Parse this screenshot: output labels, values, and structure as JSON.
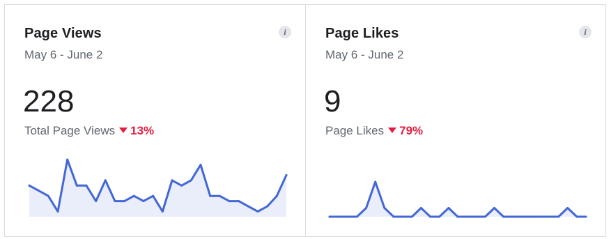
{
  "cards": [
    {
      "title": "Page Views",
      "date_range": "May 6 - June 2",
      "value": "228",
      "metric_label": "Total Page Views",
      "change": "13%",
      "change_direction": "down",
      "info_icon": "i",
      "line_color": "#4267d6",
      "fill_color": "#eaedfa",
      "chart_data": {
        "type": "area",
        "values": [
          6,
          5,
          4,
          1,
          11,
          6,
          6,
          3,
          7,
          3,
          3,
          4,
          3,
          4,
          1,
          7,
          6,
          7,
          10,
          4,
          4,
          3,
          3,
          2,
          1,
          2,
          4,
          8
        ]
      }
    },
    {
      "title": "Page Likes",
      "date_range": "May 6 - June 2",
      "value": "9",
      "metric_label": "Page Likes",
      "change": "79%",
      "change_direction": "down",
      "info_icon": "i",
      "line_color": "#4267d6",
      "fill_color": "#eaedfa",
      "chart_data": {
        "type": "area",
        "values": [
          0,
          0,
          0,
          0,
          1,
          4,
          1,
          0,
          0,
          0,
          1,
          0,
          0,
          1,
          0,
          0,
          0,
          0,
          1,
          0,
          0,
          0,
          0,
          0,
          0,
          0,
          1,
          0,
          0
        ]
      }
    }
  ]
}
